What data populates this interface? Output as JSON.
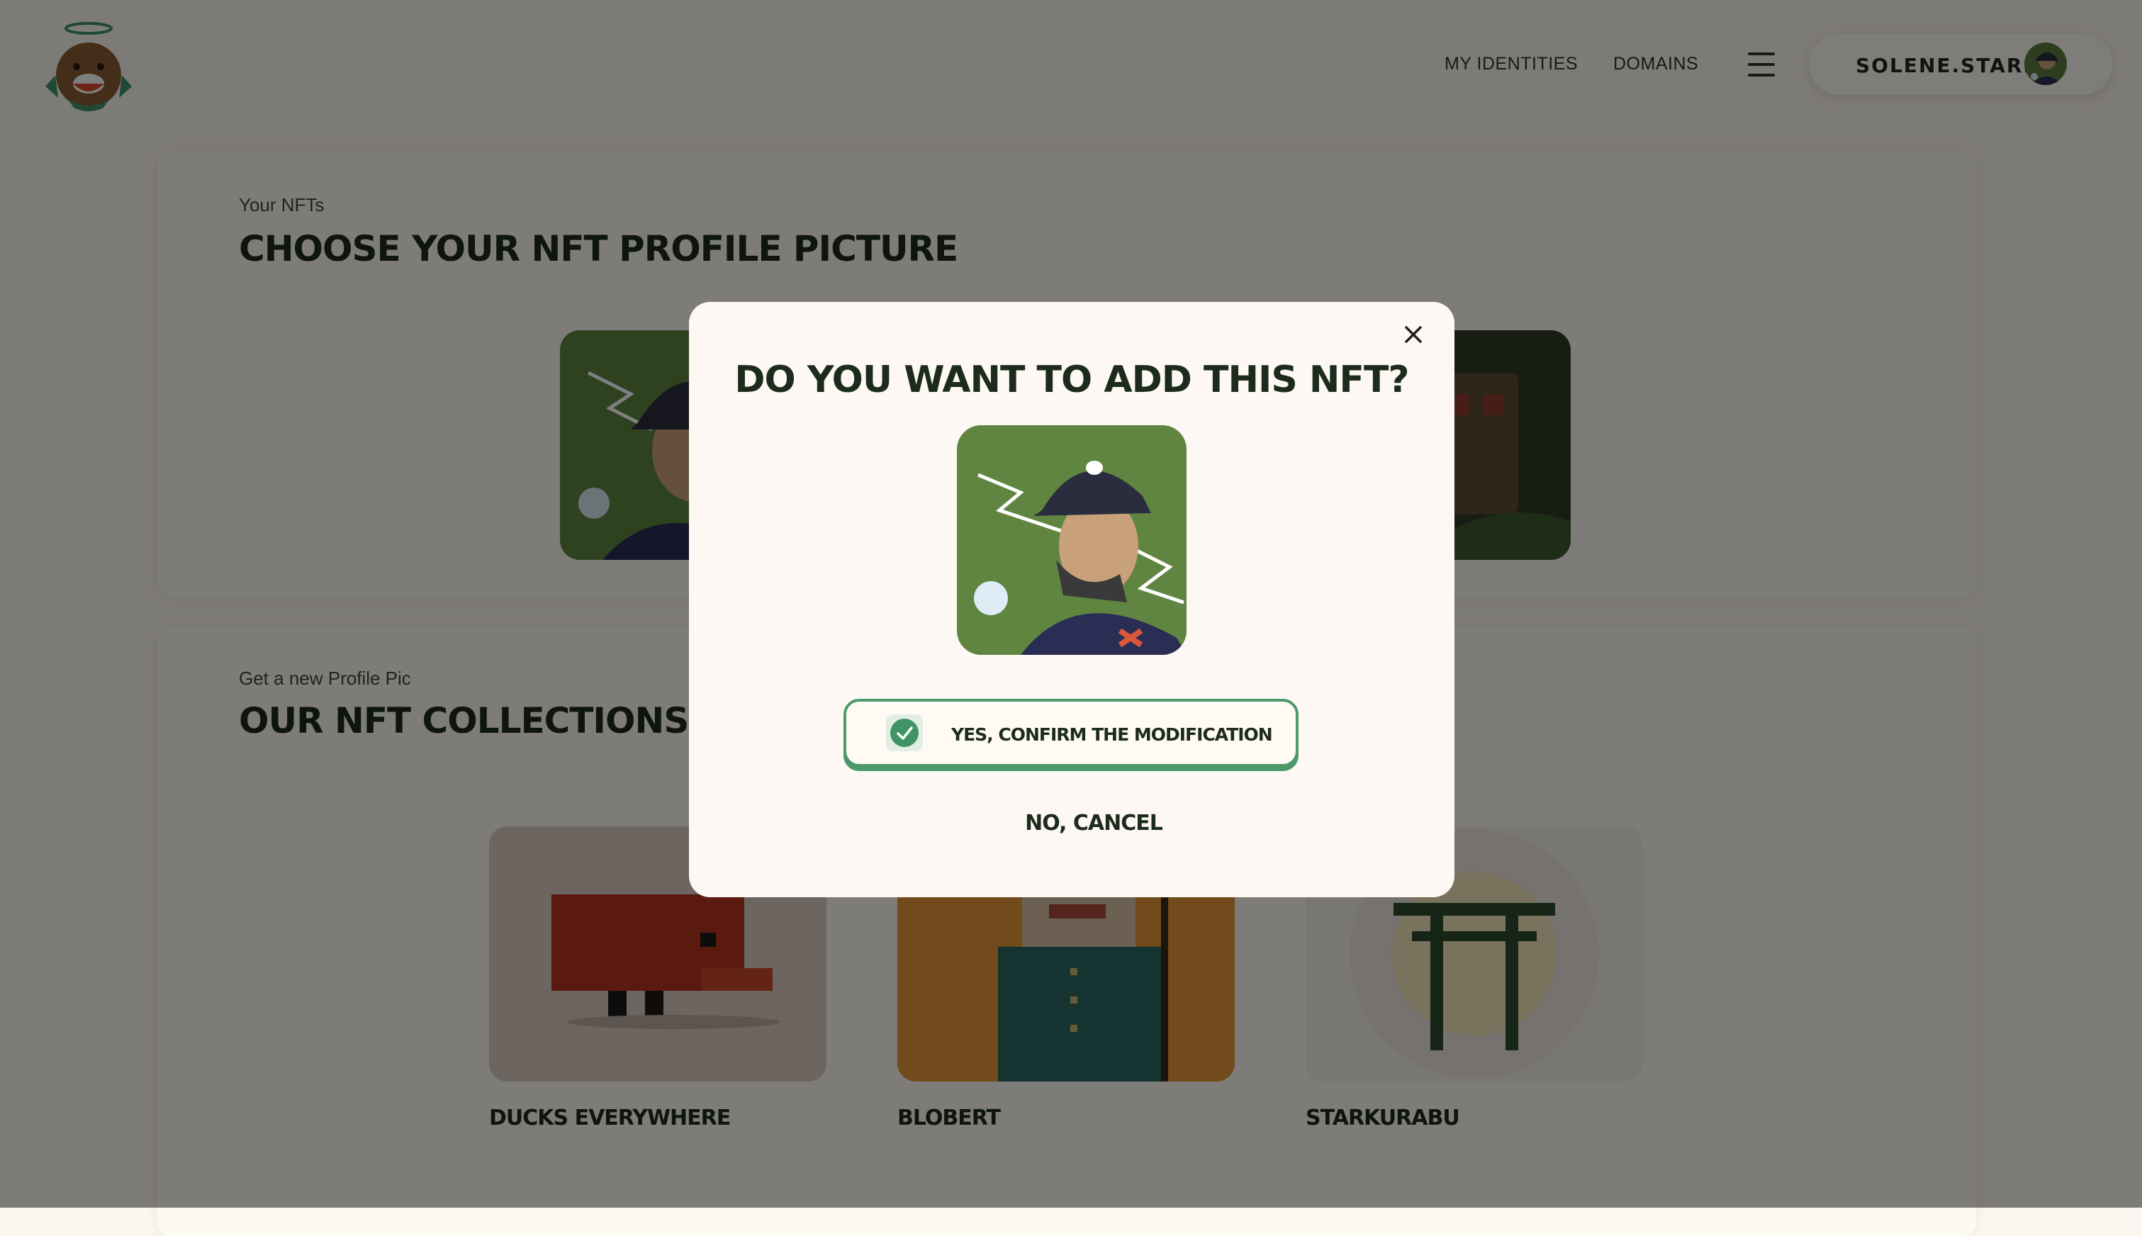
{
  "navbar": {
    "logo": "starknet-id-mascot-logo",
    "links": [
      "MY IDENTITIES",
      "DOMAINS"
    ],
    "menu_icon": "hamburger-menu-icon",
    "profile": {
      "name": "SOLENE.STARK",
      "avatar": "nft-avatar"
    }
  },
  "your_nfts": {
    "eyebrow": "Your NFTs",
    "title": "CHOOSE YOUR NFT PROFILE PICTURE"
  },
  "collections": {
    "eyebrow": "Get a new Profile Pic",
    "title": "OUR NFT COLLECTIONS SEL",
    "items": [
      {
        "name": "DUCKS EVERYWHERE"
      },
      {
        "name": "BLOBERT"
      },
      {
        "name": "STARKURABU"
      }
    ]
  },
  "modal": {
    "title": "DO YOU WANT TO ADD THIS NFT?",
    "confirm_label": "YES, CONFIRM THE MODIFICATION",
    "cancel_label": "NO, CANCEL",
    "close_icon": "close-icon",
    "check_icon": "check-icon"
  },
  "colors": {
    "accent_green": "#3f9364",
    "dark_text": "#1d2b1d",
    "background": "#fbf6ef"
  }
}
